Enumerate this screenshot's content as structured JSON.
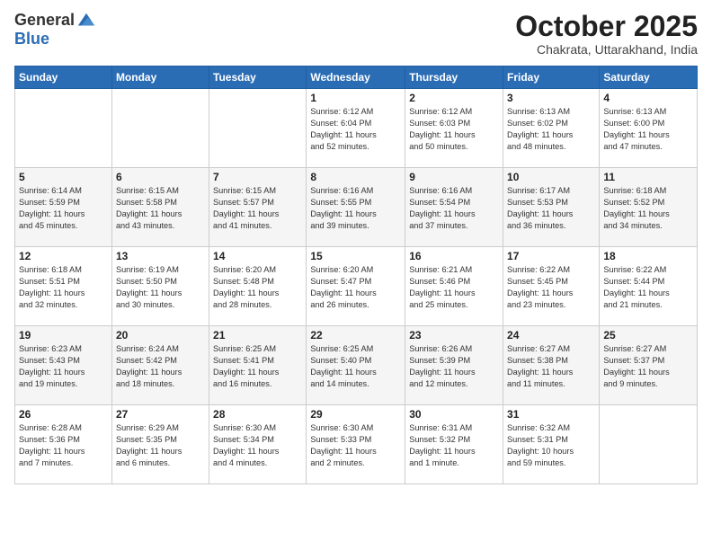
{
  "header": {
    "logo_line1": "General",
    "logo_line2": "Blue",
    "month": "October 2025",
    "location": "Chakrata, Uttarakhand, India"
  },
  "weekdays": [
    "Sunday",
    "Monday",
    "Tuesday",
    "Wednesday",
    "Thursday",
    "Friday",
    "Saturday"
  ],
  "weeks": [
    [
      {
        "day": "",
        "info": ""
      },
      {
        "day": "",
        "info": ""
      },
      {
        "day": "",
        "info": ""
      },
      {
        "day": "1",
        "info": "Sunrise: 6:12 AM\nSunset: 6:04 PM\nDaylight: 11 hours\nand 52 minutes."
      },
      {
        "day": "2",
        "info": "Sunrise: 6:12 AM\nSunset: 6:03 PM\nDaylight: 11 hours\nand 50 minutes."
      },
      {
        "day": "3",
        "info": "Sunrise: 6:13 AM\nSunset: 6:02 PM\nDaylight: 11 hours\nand 48 minutes."
      },
      {
        "day": "4",
        "info": "Sunrise: 6:13 AM\nSunset: 6:00 PM\nDaylight: 11 hours\nand 47 minutes."
      }
    ],
    [
      {
        "day": "5",
        "info": "Sunrise: 6:14 AM\nSunset: 5:59 PM\nDaylight: 11 hours\nand 45 minutes."
      },
      {
        "day": "6",
        "info": "Sunrise: 6:15 AM\nSunset: 5:58 PM\nDaylight: 11 hours\nand 43 minutes."
      },
      {
        "day": "7",
        "info": "Sunrise: 6:15 AM\nSunset: 5:57 PM\nDaylight: 11 hours\nand 41 minutes."
      },
      {
        "day": "8",
        "info": "Sunrise: 6:16 AM\nSunset: 5:55 PM\nDaylight: 11 hours\nand 39 minutes."
      },
      {
        "day": "9",
        "info": "Sunrise: 6:16 AM\nSunset: 5:54 PM\nDaylight: 11 hours\nand 37 minutes."
      },
      {
        "day": "10",
        "info": "Sunrise: 6:17 AM\nSunset: 5:53 PM\nDaylight: 11 hours\nand 36 minutes."
      },
      {
        "day": "11",
        "info": "Sunrise: 6:18 AM\nSunset: 5:52 PM\nDaylight: 11 hours\nand 34 minutes."
      }
    ],
    [
      {
        "day": "12",
        "info": "Sunrise: 6:18 AM\nSunset: 5:51 PM\nDaylight: 11 hours\nand 32 minutes."
      },
      {
        "day": "13",
        "info": "Sunrise: 6:19 AM\nSunset: 5:50 PM\nDaylight: 11 hours\nand 30 minutes."
      },
      {
        "day": "14",
        "info": "Sunrise: 6:20 AM\nSunset: 5:48 PM\nDaylight: 11 hours\nand 28 minutes."
      },
      {
        "day": "15",
        "info": "Sunrise: 6:20 AM\nSunset: 5:47 PM\nDaylight: 11 hours\nand 26 minutes."
      },
      {
        "day": "16",
        "info": "Sunrise: 6:21 AM\nSunset: 5:46 PM\nDaylight: 11 hours\nand 25 minutes."
      },
      {
        "day": "17",
        "info": "Sunrise: 6:22 AM\nSunset: 5:45 PM\nDaylight: 11 hours\nand 23 minutes."
      },
      {
        "day": "18",
        "info": "Sunrise: 6:22 AM\nSunset: 5:44 PM\nDaylight: 11 hours\nand 21 minutes."
      }
    ],
    [
      {
        "day": "19",
        "info": "Sunrise: 6:23 AM\nSunset: 5:43 PM\nDaylight: 11 hours\nand 19 minutes."
      },
      {
        "day": "20",
        "info": "Sunrise: 6:24 AM\nSunset: 5:42 PM\nDaylight: 11 hours\nand 18 minutes."
      },
      {
        "day": "21",
        "info": "Sunrise: 6:25 AM\nSunset: 5:41 PM\nDaylight: 11 hours\nand 16 minutes."
      },
      {
        "day": "22",
        "info": "Sunrise: 6:25 AM\nSunset: 5:40 PM\nDaylight: 11 hours\nand 14 minutes."
      },
      {
        "day": "23",
        "info": "Sunrise: 6:26 AM\nSunset: 5:39 PM\nDaylight: 11 hours\nand 12 minutes."
      },
      {
        "day": "24",
        "info": "Sunrise: 6:27 AM\nSunset: 5:38 PM\nDaylight: 11 hours\nand 11 minutes."
      },
      {
        "day": "25",
        "info": "Sunrise: 6:27 AM\nSunset: 5:37 PM\nDaylight: 11 hours\nand 9 minutes."
      }
    ],
    [
      {
        "day": "26",
        "info": "Sunrise: 6:28 AM\nSunset: 5:36 PM\nDaylight: 11 hours\nand 7 minutes."
      },
      {
        "day": "27",
        "info": "Sunrise: 6:29 AM\nSunset: 5:35 PM\nDaylight: 11 hours\nand 6 minutes."
      },
      {
        "day": "28",
        "info": "Sunrise: 6:30 AM\nSunset: 5:34 PM\nDaylight: 11 hours\nand 4 minutes."
      },
      {
        "day": "29",
        "info": "Sunrise: 6:30 AM\nSunset: 5:33 PM\nDaylight: 11 hours\nand 2 minutes."
      },
      {
        "day": "30",
        "info": "Sunrise: 6:31 AM\nSunset: 5:32 PM\nDaylight: 11 hours\nand 1 minute."
      },
      {
        "day": "31",
        "info": "Sunrise: 6:32 AM\nSunset: 5:31 PM\nDaylight: 10 hours\nand 59 minutes."
      },
      {
        "day": "",
        "info": ""
      }
    ]
  ]
}
